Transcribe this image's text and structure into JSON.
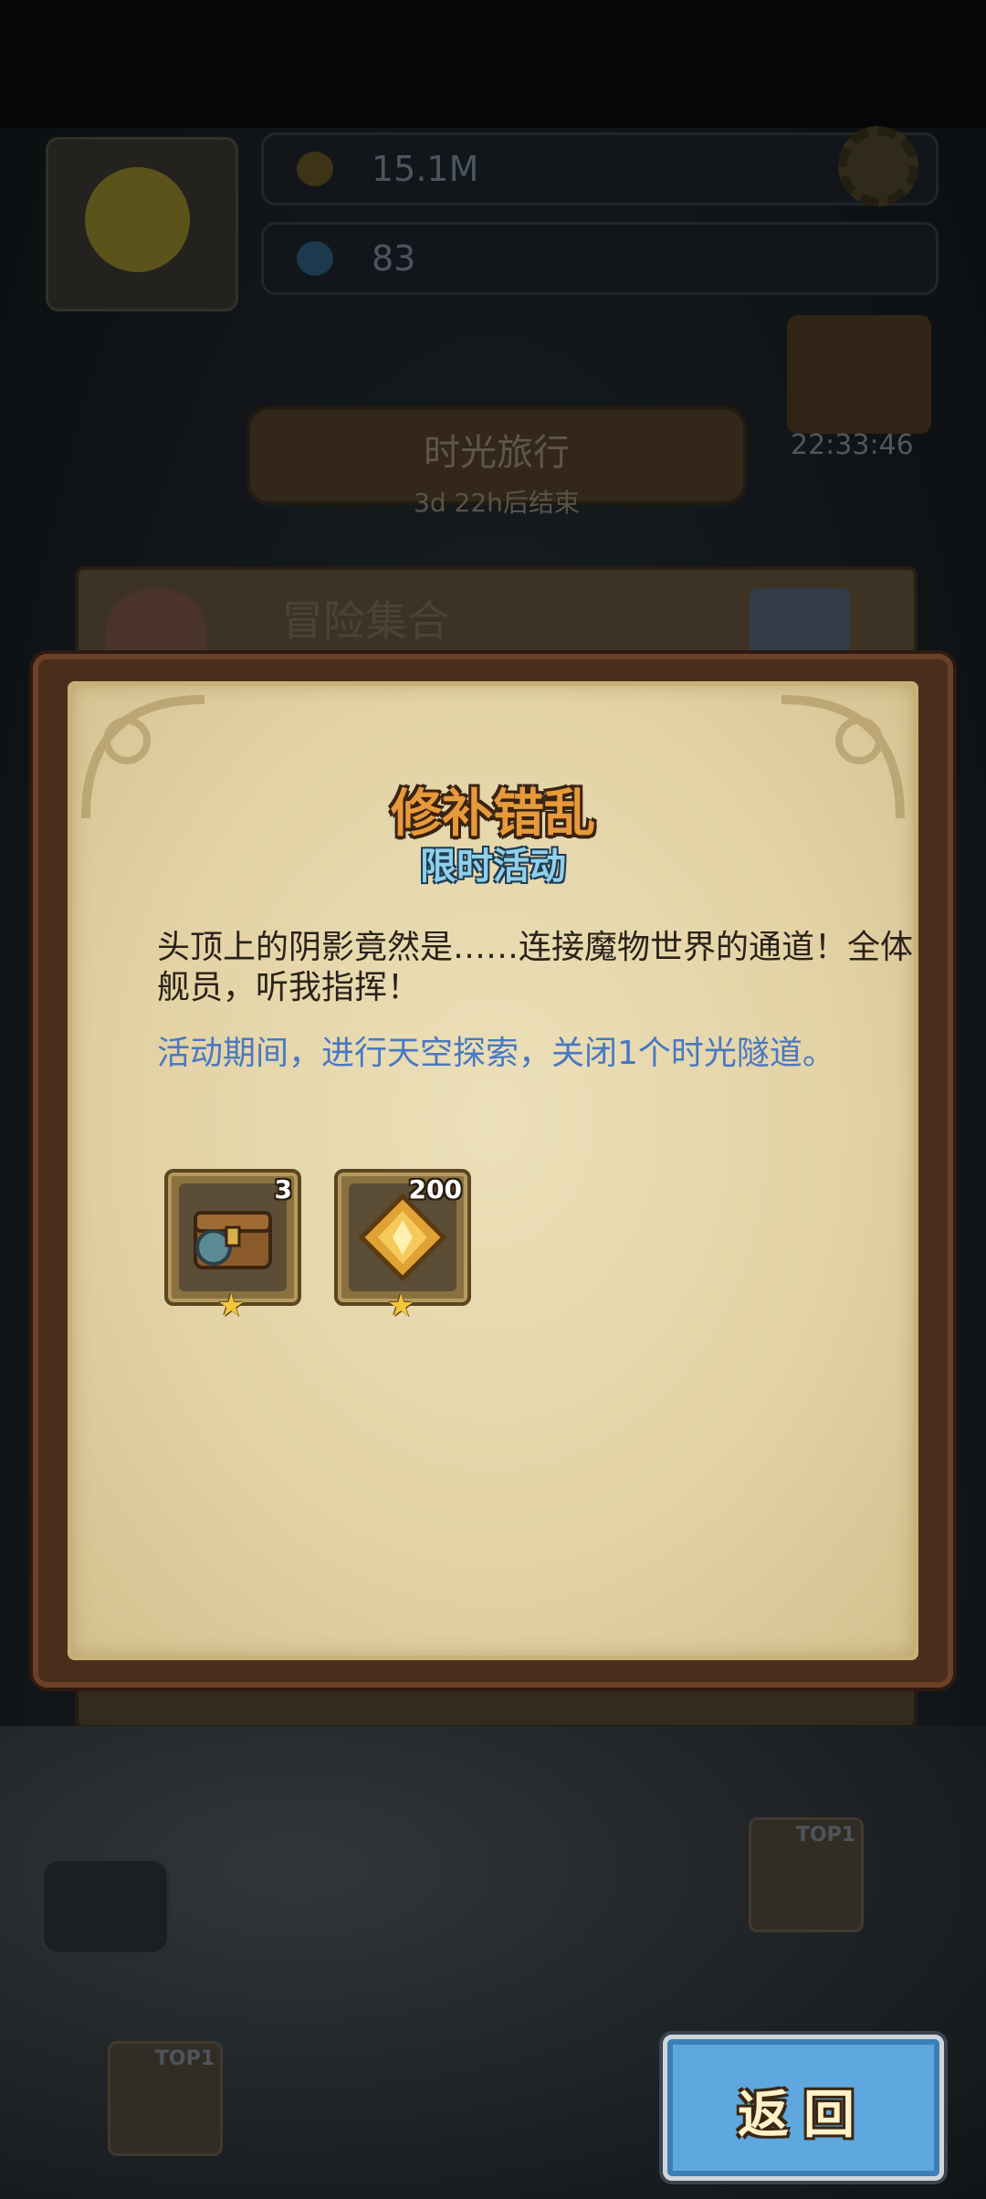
{
  "hud": {
    "gold": "15.1M",
    "gems": "83",
    "shop_timer": "22:33:46"
  },
  "event_banner": {
    "title": "时光旅行",
    "subtitle": "3d 22h后结束"
  },
  "event_card": {
    "name": "冒险集合"
  },
  "modal": {
    "title": "修补错乱",
    "subtitle": "限时活动",
    "description": "头顶上的阴影竟然是……连接魔物世界的通道！全体舰员，听我指挥！",
    "task": "活动期间，进行天空探索，关闭1个时光隧道。",
    "rewards": [
      {
        "icon": "treasure-chest-icon",
        "count": "3",
        "stars": "★"
      },
      {
        "icon": "gold-crystal-icon",
        "count": "200",
        "stars": "★"
      }
    ]
  },
  "map": {
    "top_badge_1": "TOP1",
    "top_badge_2": "TOP1"
  },
  "buttons": {
    "return_label": "返回"
  },
  "colors": {
    "title_orange": "#e79a3b",
    "subtitle_blue": "#8fd0ea",
    "task_blue": "#4a78c2",
    "paper": "#e3d3a6",
    "return_button": "#5ea8df"
  }
}
